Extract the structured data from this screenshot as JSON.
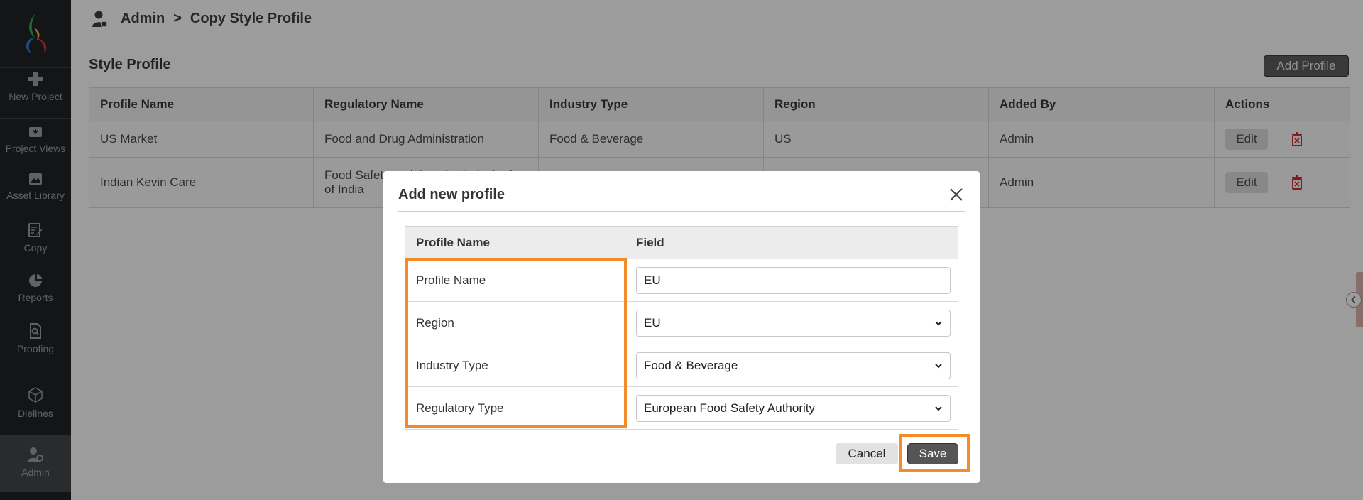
{
  "sidebar": {
    "items": [
      {
        "label": "New Project",
        "icon": "plus-icon"
      },
      {
        "label": "Project Views",
        "icon": "inbox-download-icon"
      },
      {
        "label": "Asset Library",
        "icon": "image-icon"
      },
      {
        "label": "Copy",
        "icon": "edit-document-icon"
      },
      {
        "label": "Reports",
        "icon": "pie-chart-icon"
      },
      {
        "label": "Proofing",
        "icon": "document-search-icon"
      },
      {
        "label": "Dielines",
        "icon": "cube-icon"
      },
      {
        "label": "Admin",
        "icon": "user-gear-icon"
      }
    ]
  },
  "breadcrumb": {
    "root": "Admin",
    "separator": ">",
    "current": "Copy Style Profile"
  },
  "page": {
    "title": "Style Profile",
    "add_button": "Add Profile"
  },
  "table": {
    "headers": [
      "Profile Name",
      "Regulatory Name",
      "Industry Type",
      "Region",
      "Added By",
      "Actions"
    ],
    "rows": [
      {
        "profile_name": "US Market",
        "regulatory_name": "Food and Drug Administration",
        "industry_type": "Food & Beverage",
        "region": "US",
        "added_by": "Admin"
      },
      {
        "profile_name": "Indian Kevin Care",
        "regulatory_name_line1": "Food Safety and Standards Authority",
        "regulatory_name_line2": "of India",
        "added_by": "Admin"
      }
    ],
    "edit_label": "Edit"
  },
  "modal": {
    "title": "Add new profile",
    "headers": [
      "Profile Name",
      "Field"
    ],
    "rows": [
      {
        "label": "Profile Name",
        "value": "EU"
      },
      {
        "label": "Region",
        "value": "EU"
      },
      {
        "label": "Industry Type",
        "value": "Food & Beverage"
      },
      {
        "label": "Regulatory Type",
        "value": "European Food Safety Authority"
      }
    ],
    "cancel_label": "Cancel",
    "save_label": "Save"
  },
  "colors": {
    "highlight": "#f28b2a",
    "delete": "#c0292b",
    "sidebar_bg": "#1c1f22"
  }
}
